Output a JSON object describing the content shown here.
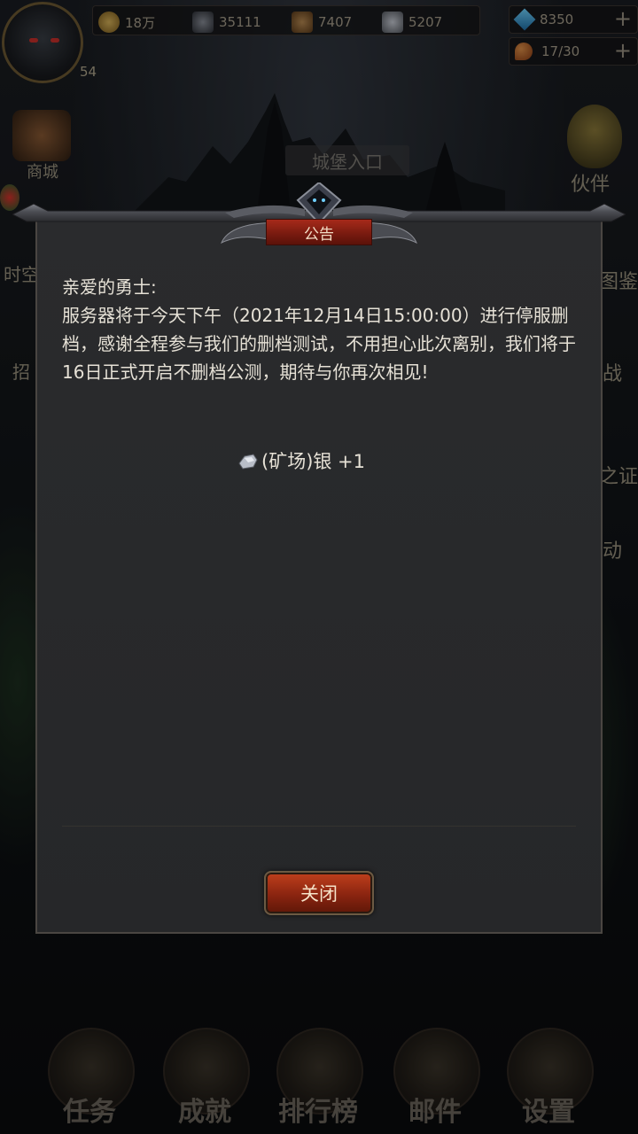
{
  "top_bar": {
    "player_level": "54",
    "resources": [
      {
        "icon": "gold-coin-icon",
        "value": "18万"
      },
      {
        "icon": "iron-ore-icon",
        "value": "35111"
      },
      {
        "icon": "wood-icon",
        "value": "7407"
      },
      {
        "icon": "silver-ore-icon",
        "value": "5207"
      }
    ],
    "diamond": {
      "icon": "diamond-icon",
      "value": "8350",
      "plus": "+"
    },
    "stamina": {
      "icon": "drumstick-icon",
      "value": "17/30",
      "plus": "+"
    }
  },
  "background": {
    "castle_entrance": "城堡入口",
    "left_menu": [
      "商城",
      "时空",
      "招"
    ],
    "right_menu": [
      "伙伴",
      "图鉴",
      "战",
      "之证",
      "动"
    ]
  },
  "dialog": {
    "title": "公告",
    "body": "亲爱的勇士:\n服务器将于今天下午（2021年12月14日15:00:00）进行停服删档，感谢全程参与我们的删档测试，不用担心此次离别，我们将于16日正式开启不删档公测，期待与你再次相见!",
    "reward": "(矿场)银 +1",
    "close_label": "关闭"
  },
  "bottom_nav": [
    "任务",
    "成就",
    "排行榜",
    "邮件",
    "设置"
  ],
  "colors": {
    "dialog_bg": "#262729",
    "title_plate": "#8a2410",
    "close_button": "#a8341a",
    "text": "#e6e1d6"
  }
}
